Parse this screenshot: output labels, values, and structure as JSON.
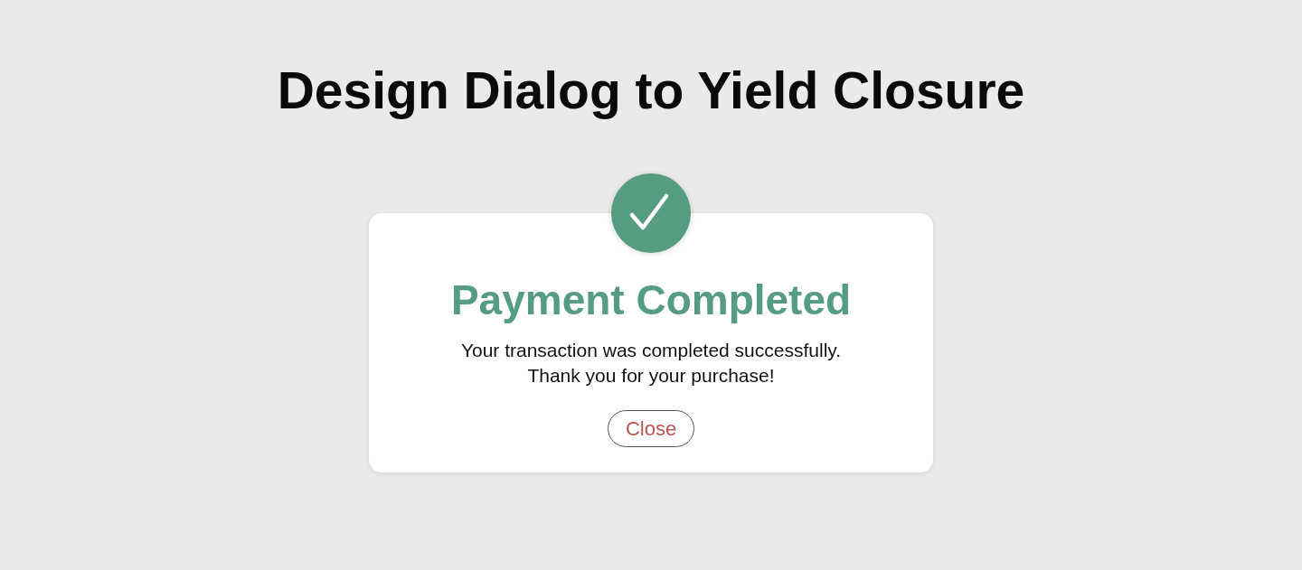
{
  "page": {
    "title": "Design Dialog to Yield Closure"
  },
  "dialog": {
    "title": "Payment Completed",
    "message": [
      "Your transaction was completed successfully.",
      "Thank you for your purchase!"
    ],
    "buttons": [
      "Close"
    ]
  }
}
